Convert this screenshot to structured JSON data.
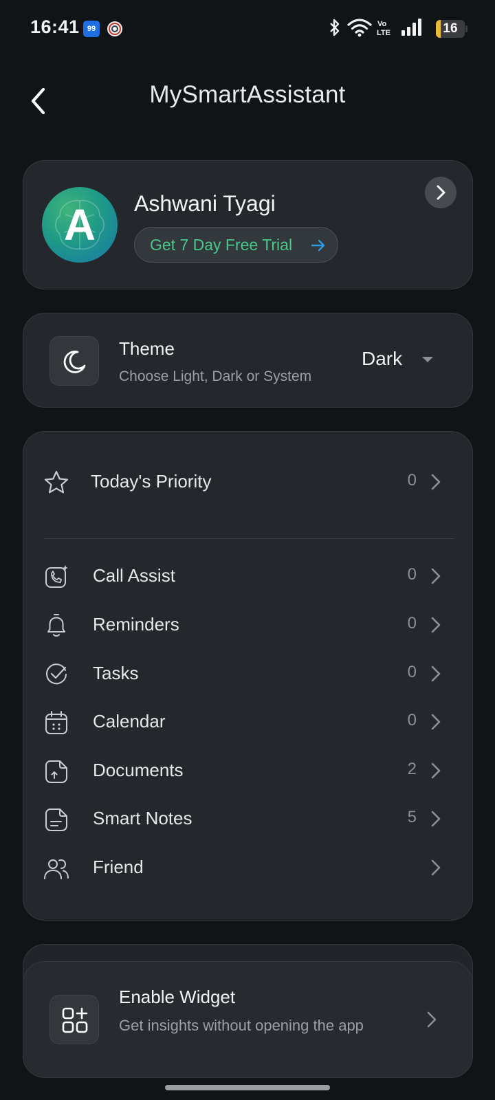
{
  "status_bar": {
    "time": "16:41",
    "notification_badge": "99",
    "battery_level": "16",
    "battery_fraction": 0.16,
    "icons": [
      "bluetooth-icon",
      "wifi-icon",
      "volte-icon",
      "signal-icon",
      "battery-icon"
    ]
  },
  "header": {
    "title": "MySmartAssistant",
    "back_icon": "back-arrow-icon"
  },
  "profile": {
    "avatar_letter": "A",
    "name": "Ashwani Tyagi",
    "trial_label": "Get 7 Day Free Trial",
    "trial_icon": "arrow-right-icon",
    "open_icon": "chevron-right-icon"
  },
  "theme": {
    "title": "Theme",
    "subtitle": "Choose Light, Dark or System",
    "value": "Dark",
    "icon": "moon-icon"
  },
  "menu": {
    "priority": {
      "label": "Today's Priority",
      "count": "0",
      "icon": "star-icon"
    },
    "items": [
      {
        "label": "Call Assist",
        "count": "0",
        "icon": "call-assist-icon"
      },
      {
        "label": "Reminders",
        "count": "0",
        "icon": "bell-icon"
      },
      {
        "label": "Tasks",
        "count": "0",
        "icon": "check-circle-icon"
      },
      {
        "label": "Calendar",
        "count": "0",
        "icon": "calendar-icon"
      },
      {
        "label": "Documents",
        "count": "2",
        "icon": "document-upload-icon"
      },
      {
        "label": "Smart Notes",
        "count": "5",
        "icon": "note-icon"
      },
      {
        "label": "Friend",
        "count": "",
        "icon": "friends-icon"
      }
    ]
  },
  "widget": {
    "title": "Enable Widget",
    "subtitle": "Get insights without opening the app",
    "icon": "widget-add-icon"
  },
  "colors": {
    "background": "#111417",
    "card": "#24272b",
    "accent_green": "#49c889",
    "accent_blue": "#2f9be0",
    "text_secondary": "#9aa0a6"
  }
}
